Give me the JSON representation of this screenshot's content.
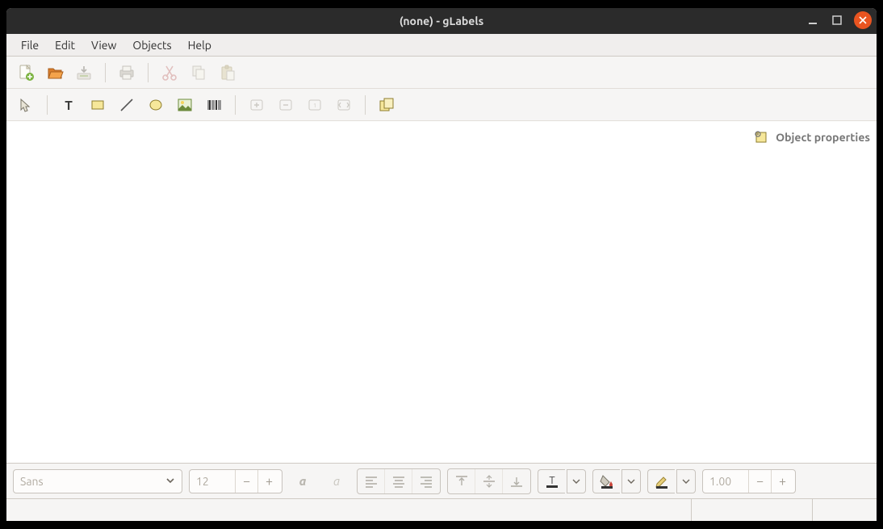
{
  "title": "(none) - gLabels",
  "menu": [
    "File",
    "Edit",
    "View",
    "Objects",
    "Help"
  ],
  "sidebar_label": "Object properties",
  "font_family": "Sans",
  "font_size": "12",
  "line_width": "1.00",
  "icons": {
    "new": "new-file-icon",
    "open": "open-file-icon",
    "save": "save-icon",
    "print": "print-icon",
    "cut": "cut-icon",
    "copy": "copy-icon",
    "paste": "paste-icon",
    "select": "select-mode-icon",
    "text": "text-tool-icon",
    "box": "box-tool-icon",
    "line": "line-tool-icon",
    "ellipse": "ellipse-tool-icon",
    "image": "image-tool-icon",
    "barcode": "barcode-tool-icon",
    "zoom_in": "zoom-in-icon",
    "zoom_out": "zoom-out-icon",
    "zoom_1": "zoom-1to1-icon",
    "zoom_fit": "zoom-fit-icon",
    "merge": "merge-properties-icon"
  }
}
